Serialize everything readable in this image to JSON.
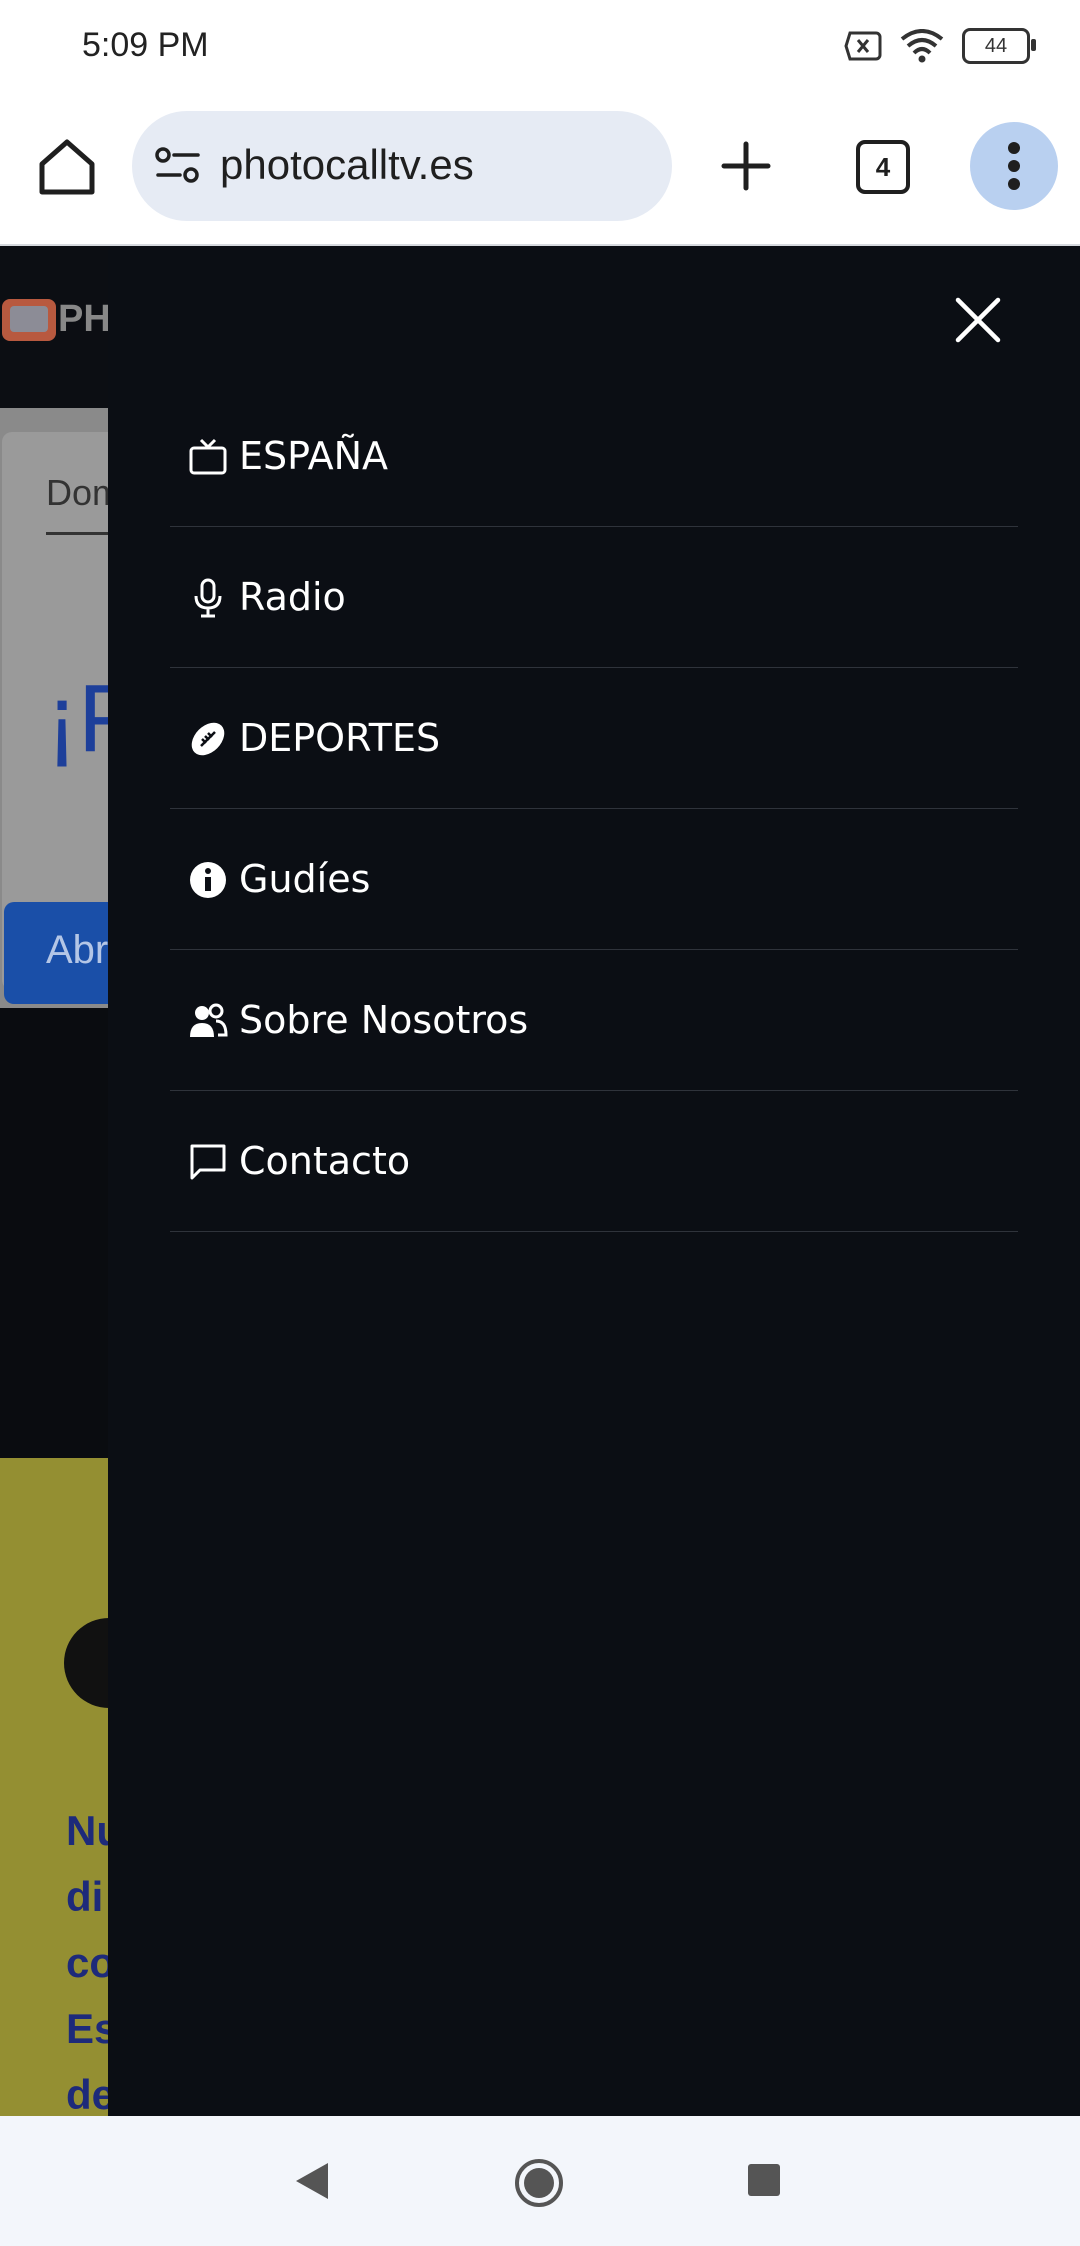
{
  "status_bar": {
    "time": "5:09 PM",
    "battery": "44"
  },
  "browser": {
    "url": "photocalltv.es",
    "tab_count": "4"
  },
  "page": {
    "logo_text": "PH",
    "consent_field": "Dom",
    "consent_headline": "¡F",
    "consent_button": "Abr",
    "promo_text": "Nu\ndi\nco\nEs\nde"
  },
  "drawer": {
    "items": [
      {
        "label": "ESPAÑA",
        "icon": "tv-icon"
      },
      {
        "label": "Radio",
        "icon": "microphone-icon"
      },
      {
        "label": "DEPORTES",
        "icon": "football-icon"
      },
      {
        "label": "Gudíes",
        "icon": "info-icon"
      },
      {
        "label": "Sobre Nosotros",
        "icon": "users-icon"
      },
      {
        "label": "Contacto",
        "icon": "chat-icon"
      }
    ]
  }
}
